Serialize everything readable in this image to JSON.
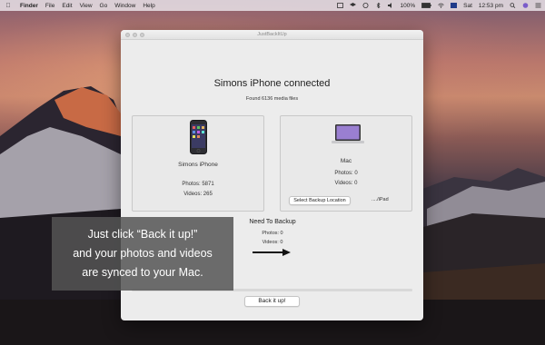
{
  "menubar": {
    "items": [
      "Finder",
      "File",
      "Edit",
      "View",
      "Go",
      "Window",
      "Help"
    ],
    "battery": "100%",
    "day": "Sat",
    "time": "12:53 pm"
  },
  "window": {
    "title": "JustBackItUp",
    "heading": "Simons iPhone connected",
    "subheading": "Found 6136 media files",
    "source": {
      "name": "Simons iPhone",
      "photos": "Photos: 5871",
      "videos": "Videos: 265"
    },
    "destination": {
      "name": "Mac",
      "photos": "Photos: 0",
      "videos": "Videos: 0",
      "select_button": "Select Backup Location",
      "location": "..../iPad"
    },
    "need": {
      "title": "Need To Backup",
      "photos": "Photos: 0",
      "videos": "Videos: 0"
    },
    "progress": 0,
    "backup_button": "Back it up!"
  },
  "caption": {
    "line1": "Just click “Back it up!”",
    "line2": "and your photos and videos",
    "line3": "are synced to your Mac."
  },
  "colors": {
    "accent": "#5b9af0",
    "window_bg": "#ececec",
    "caption_bg": "#555555"
  }
}
